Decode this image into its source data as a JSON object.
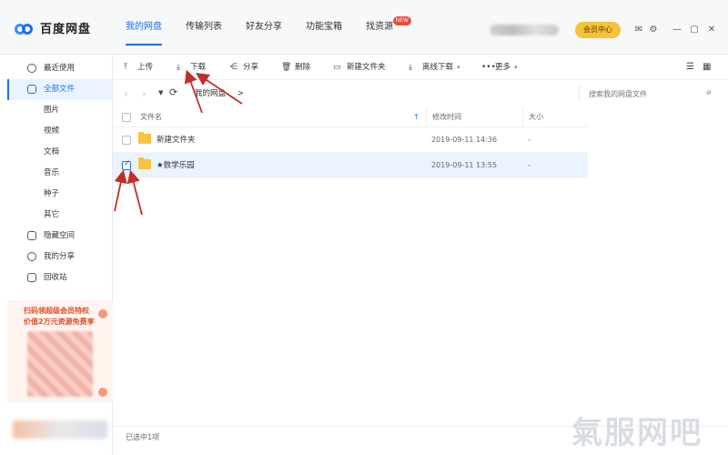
{
  "app": {
    "name": "百度网盘"
  },
  "nav": {
    "tabs": [
      {
        "label": "我的网盘",
        "active": true
      },
      {
        "label": "传输列表"
      },
      {
        "label": "好友分享"
      },
      {
        "label": "功能宝箱"
      },
      {
        "label": "找资源",
        "badge": "NEW"
      }
    ]
  },
  "header": {
    "vip_label": "会员中心"
  },
  "sidebar": {
    "items": [
      {
        "label": "最近使用",
        "icon": "clock-icon"
      },
      {
        "label": "全部文件",
        "icon": "file-icon",
        "active": true
      }
    ],
    "subitems": [
      "图片",
      "视频",
      "文档",
      "音乐",
      "种子",
      "其它"
    ],
    "items2": [
      {
        "label": "隐藏空间",
        "icon": "lock-icon"
      },
      {
        "label": "我的分享",
        "icon": "share-icon"
      },
      {
        "label": "回收站",
        "icon": "trash-icon"
      }
    ],
    "promo": {
      "line1": "扫码领超级会员特权",
      "line2": "价值2万元资源免费享"
    }
  },
  "toolbar": {
    "upload": "上传",
    "download": "下载",
    "share": "分享",
    "delete": "删除",
    "new_folder": "新建文件夹",
    "offline_download": "离线下载",
    "more": "更多"
  },
  "path": {
    "root": "我的网盘",
    "sep": ">"
  },
  "search": {
    "placeholder": "搜索我的网盘文件"
  },
  "table": {
    "headers": {
      "name": "文件名",
      "modified": "修改时间",
      "size": "大小"
    },
    "rows": [
      {
        "name": "新建文件夹",
        "modified": "2019-09-11 14:36",
        "size": "-",
        "checked": false,
        "selected": false
      },
      {
        "name": "★数学乐园",
        "modified": "2019-09-11 13:55",
        "size": "-",
        "checked": true,
        "selected": true
      }
    ]
  },
  "status": {
    "text": "已选中1项"
  },
  "watermark": "氣服网吧",
  "colors": {
    "accent": "#1f6fe8",
    "arrow": "#c0302a",
    "vip": "#f5c23a"
  }
}
